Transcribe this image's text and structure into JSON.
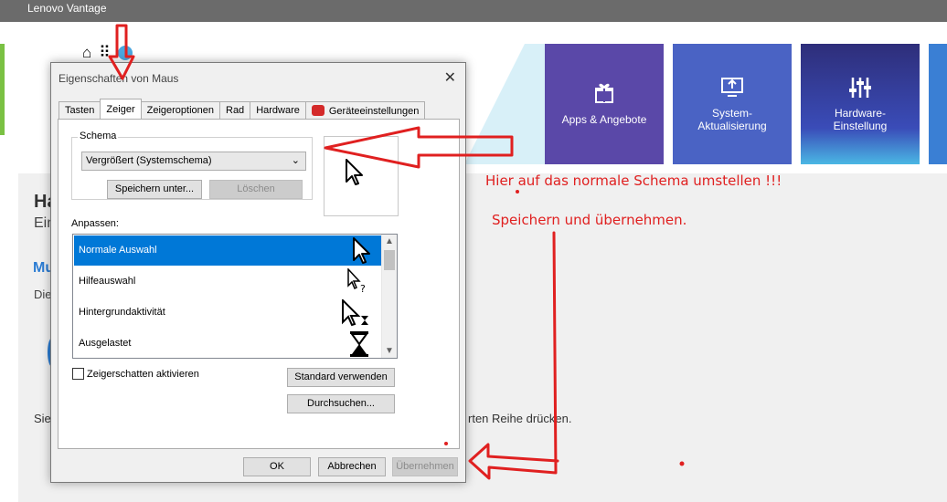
{
  "app": {
    "title": "Lenovo Vantage"
  },
  "colors": {
    "accent": "#0078d7",
    "annotation": "#e02020",
    "tile_apps": "#5a48a8",
    "tile_system": "#4a63c4",
    "tile_hardware": "#2e2e7a"
  },
  "toolbar": {
    "home_icon": "⌂",
    "grid_icon": "⠿"
  },
  "tiles": [
    {
      "label": "Apps & Angebote",
      "icon": "gift-icon",
      "glyph": "🎁"
    },
    {
      "label": "System-\nAktualisierung",
      "icon": "update-icon",
      "glyph": "⇪"
    },
    {
      "label": "Hardware-\nEinstellung",
      "icon": "sliders-icon",
      "glyph": "⫶"
    }
  ],
  "background": {
    "heading": "Ha",
    "subheading": "Ein",
    "brand": "Mu",
    "line1": "Die",
    "line2": "Sie",
    "line2_tail": "rten Reihe drücken."
  },
  "annotations": {
    "note1": "Hier auf das normale Schema umstellen !!!",
    "note2": "Speichern  und übernehmen."
  },
  "dialog": {
    "title": "Eigenschaften von Maus",
    "close": "✕",
    "tabs": [
      "Tasten",
      "Zeiger",
      "Zeigeroptionen",
      "Rad",
      "Hardware",
      "Geräteeinstellungen"
    ],
    "scheme_group": "Schema",
    "scheme_value": "Vergrößert (Systemschema)",
    "save_as": "Speichern unter...",
    "delete": "Löschen",
    "customize_label": "Anpassen:",
    "list_items": [
      {
        "label": "Normale Auswahl",
        "icon": "arrow-cursor-icon"
      },
      {
        "label": "Hilfeauswahl",
        "icon": "help-cursor-icon"
      },
      {
        "label": "Hintergrundaktivität",
        "icon": "busy-cursor-icon"
      },
      {
        "label": "Ausgelastet",
        "icon": "hourglass-icon"
      }
    ],
    "shadow_checkbox": "Zeigerschatten aktivieren",
    "use_default": "Standard verwenden",
    "browse": "Durchsuchen...",
    "ok": "OK",
    "cancel": "Abbrechen",
    "apply": "Übernehmen"
  }
}
